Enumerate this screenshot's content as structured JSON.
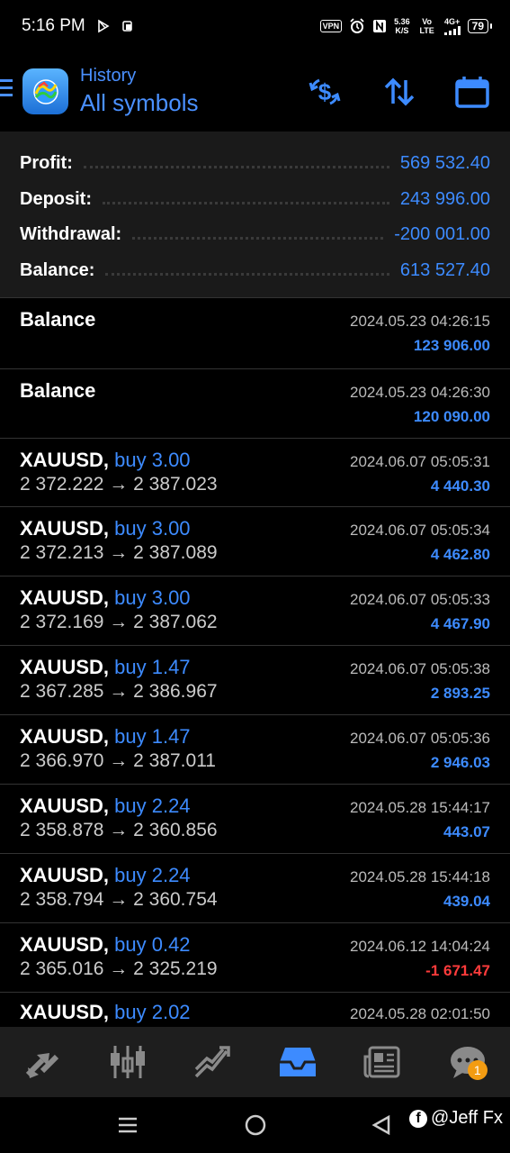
{
  "status_bar": {
    "time": "5:16 PM",
    "vpn": "VPN",
    "net_speed_value": "5.36",
    "net_speed_unit": "K/S",
    "volte": "Vo LTE",
    "signal": "4G+",
    "battery": "79"
  },
  "header": {
    "title_small": "History",
    "title_big": "All symbols"
  },
  "summary": [
    {
      "label": "Profit:",
      "value": "569 532.40"
    },
    {
      "label": "Deposit:",
      "value": "243 996.00"
    },
    {
      "label": "Withdrawal:",
      "value": "-200 001.00"
    },
    {
      "label": "Balance:",
      "value": "613 527.40"
    }
  ],
  "balance_entries": [
    {
      "title": "Balance",
      "date": "2024.05.23 04:26:15",
      "amount": "123 906.00"
    },
    {
      "title": "Balance",
      "date": "2024.05.23 04:26:30",
      "amount": "120 090.00"
    }
  ],
  "trades": [
    {
      "symbol": "XAUUSD,",
      "side": "buy 3.00",
      "open": "2 372.222",
      "arrow": "→",
      "close": "2 387.023",
      "date": "2024.06.07 05:05:31",
      "amount": "4 440.30"
    },
    {
      "symbol": "XAUUSD,",
      "side": "buy 3.00",
      "open": "2 372.213",
      "arrow": "→",
      "close": "2 387.089",
      "date": "2024.06.07 05:05:34",
      "amount": "4 462.80"
    },
    {
      "symbol": "XAUUSD,",
      "side": "buy 3.00",
      "open": "2 372.169",
      "arrow": "→",
      "close": "2 387.062",
      "date": "2024.06.07 05:05:33",
      "amount": "4 467.90"
    },
    {
      "symbol": "XAUUSD,",
      "side": "buy 1.47",
      "open": "2 367.285",
      "arrow": "→",
      "close": "2 386.967",
      "date": "2024.06.07 05:05:38",
      "amount": "2 893.25"
    },
    {
      "symbol": "XAUUSD,",
      "side": "buy 1.47",
      "open": "2 366.970",
      "arrow": "→",
      "close": "2 387.011",
      "date": "2024.06.07 05:05:36",
      "amount": "2 946.03"
    },
    {
      "symbol": "XAUUSD,",
      "side": "buy 2.24",
      "open": "2 358.878",
      "arrow": "→",
      "close": "2 360.856",
      "date": "2024.05.28 15:44:17",
      "amount": "443.07"
    },
    {
      "symbol": "XAUUSD,",
      "side": "buy 2.24",
      "open": "2 358.794",
      "arrow": "→",
      "close": "2 360.754",
      "date": "2024.05.28 15:44:18",
      "amount": "439.04"
    },
    {
      "symbol": "XAUUSD,",
      "side": "buy 0.42",
      "open": "2 365.016",
      "arrow": "→",
      "close": "2 325.219",
      "date": "2024.06.12 14:04:24",
      "amount": "-1 671.47"
    },
    {
      "symbol": "XAUUSD,",
      "side": "buy 2.02",
      "open": "",
      "arrow": "",
      "close": "",
      "date": "2024.05.28 02:01:50",
      "amount": ""
    }
  ],
  "tabbar": {
    "chat_badge": "1"
  },
  "watermark": {
    "fb": "f",
    "handle": "@Jeff Fx"
  },
  "colors": {
    "accent": "#3d8bff",
    "negative": "#ff3b3b",
    "summary_bg": "#1a1a1a",
    "tabbar_bg": "#1e1e1e",
    "badge": "#f39c12"
  },
  "icons": {
    "tabs": [
      "quotes-icon",
      "chart-icon",
      "trade-icon",
      "history-icon",
      "news-icon",
      "chat-icon"
    ],
    "header": [
      "deposit-exchange-icon",
      "sort-icon",
      "calendar-icon"
    ]
  }
}
